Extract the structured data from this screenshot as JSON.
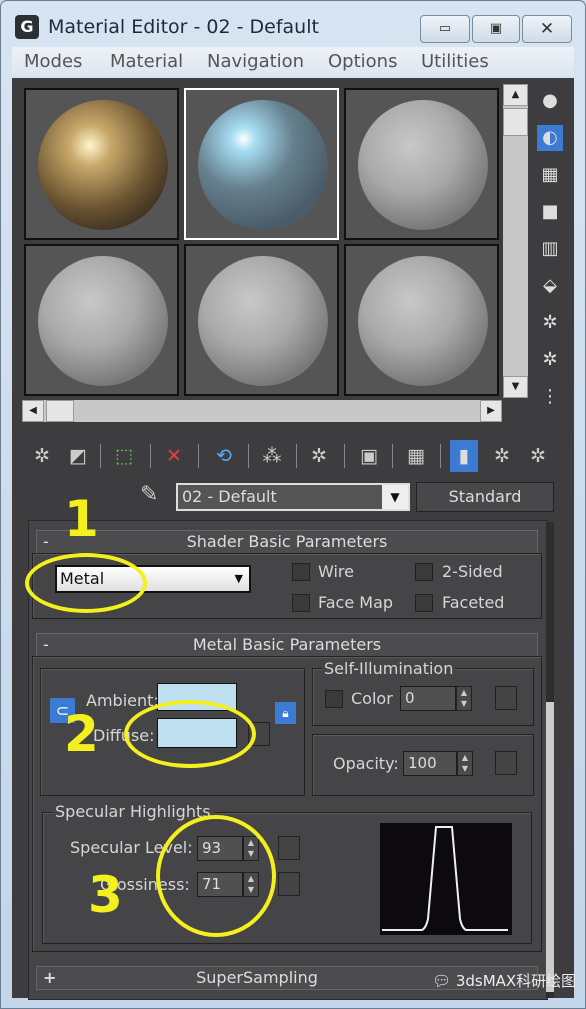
{
  "window": {
    "title": "Material Editor - 02 - Default",
    "app_icon": "3dsmax-logo-icon",
    "controls": [
      "minimize-icon",
      "maximize-icon",
      "close-icon"
    ]
  },
  "menu": [
    "Modes",
    "Material",
    "Navigation",
    "Options",
    "Utilities"
  ],
  "slots": [
    {
      "type": "metal-gold",
      "selected": false
    },
    {
      "type": "metal-blue",
      "selected": true
    },
    {
      "type": "default-gray",
      "selected": false
    },
    {
      "type": "default-gray",
      "selected": false
    },
    {
      "type": "default-gray",
      "selected": false
    },
    {
      "type": "default-gray",
      "selected": false
    }
  ],
  "material": {
    "name": "02 - Default",
    "type_button": "Standard"
  },
  "shader": {
    "header": "Shader Basic Parameters",
    "collapse": "-",
    "shader_type": "Metal",
    "wire": "Wire",
    "two_sided": "2-Sided",
    "face_map": "Face Map",
    "faceted": "Faceted"
  },
  "metal": {
    "header": "Metal Basic Parameters",
    "collapse": "-",
    "ambient_label": "Ambient:",
    "diffuse_label": "Diffuse:",
    "diffuse_color": "#bfe0f0",
    "self_illum_title": "Self-Illumination",
    "color_label": "Color",
    "self_illum_value": "0",
    "opacity_label": "Opacity:",
    "opacity_value": "100"
  },
  "specular": {
    "title": "Specular Highlights",
    "level_label": "Specular Level:",
    "level_value": "93",
    "gloss_label": "Glossiness:",
    "gloss_value": "71"
  },
  "supersampling": {
    "header": "SuperSampling",
    "expand": "+"
  },
  "annotations": {
    "one": "1",
    "two": "2",
    "three": "3",
    "color": "#f4f01e"
  },
  "watermark": "3dsMAX科研绘图"
}
